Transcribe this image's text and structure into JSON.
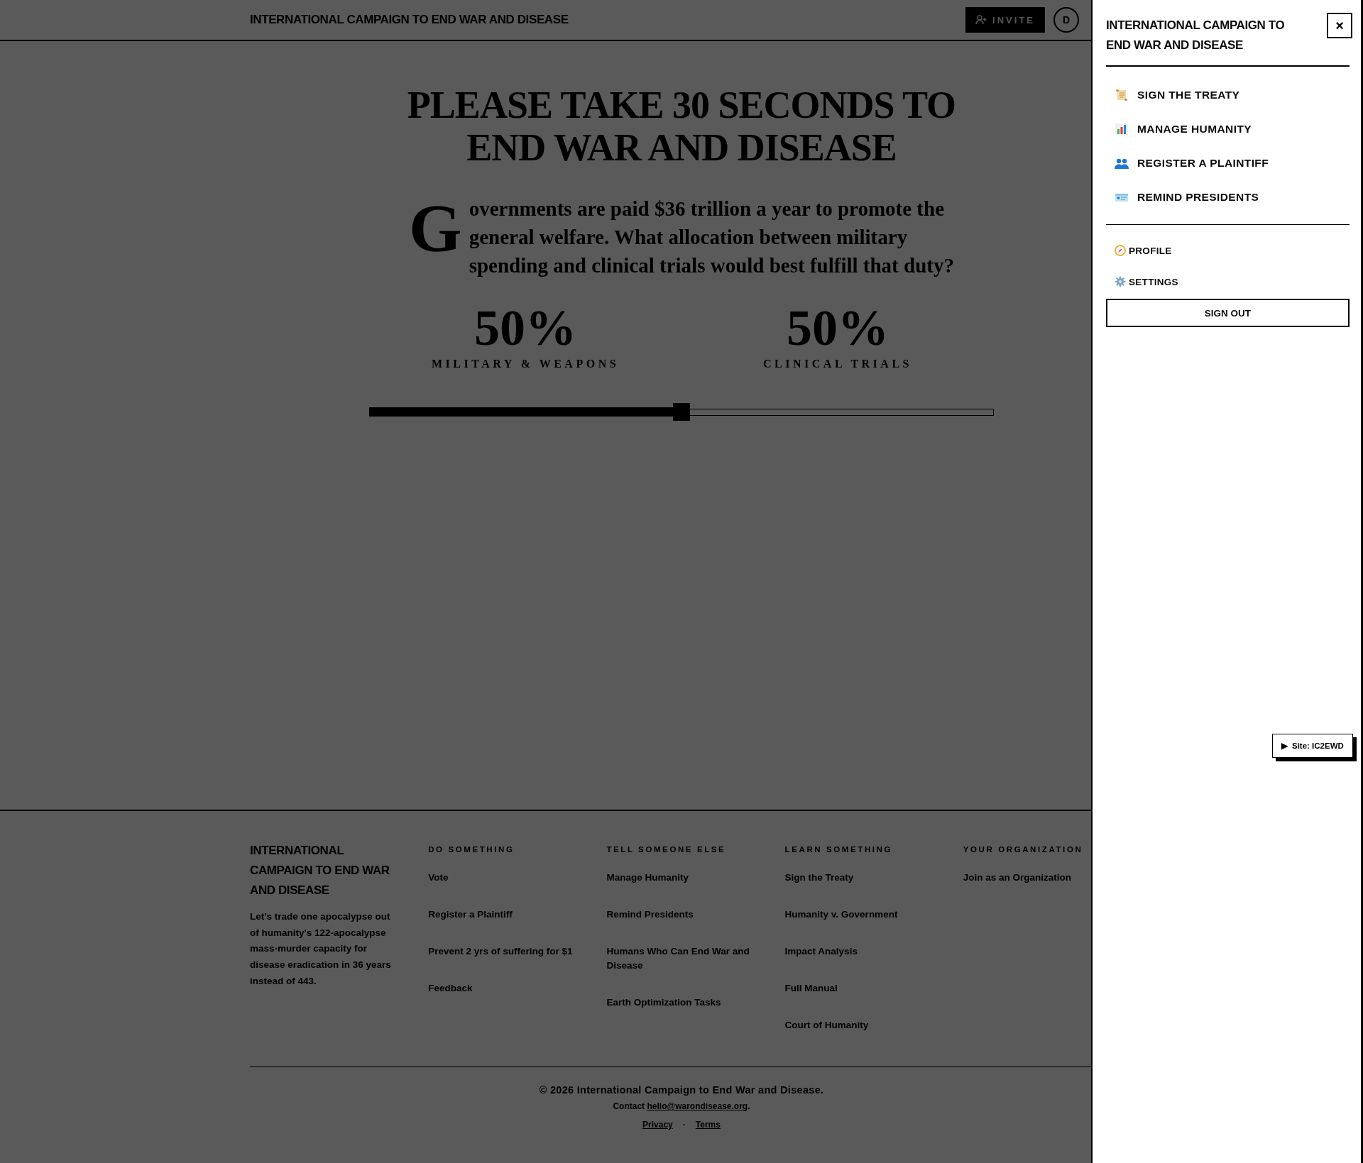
{
  "header": {
    "title": "INTERNATIONAL CAMPAIGN TO END WAR AND DISEASE",
    "invite_button": "INVITE",
    "avatar": "D"
  },
  "question": {
    "title": "PLEASE TAKE 30 SECONDS TO END WAR AND DISEASE",
    "drop_cap": "G",
    "text": "overnments are paid $36 trillion a year to promote the general welfare. What allocation between military spending and clinical trials would best fulfill that duty?"
  },
  "allocations": [
    {
      "value": "50%",
      "label": "MILITARY & WEAPONS"
    },
    {
      "value": "50%",
      "label": "CLINICAL TRIALS"
    }
  ],
  "slider": {
    "level": 0.5
  },
  "footer": {
    "brand": "INTERNATIONAL CAMPAIGN TO END WAR AND DISEASE",
    "tagline": "Let's trade one apocalypse out of humanity's **122**-apocalypse mass-murder capacity for disease eradication in **36** years instead of **443**.",
    "columns": [
      {
        "heading": "DO SOMETHING",
        "links": [
          "Vote",
          "Register a Plaintiff",
          "Prevent 2 yrs of suffering for $1",
          "Feedback"
        ]
      },
      {
        "heading": "TELL SOMEONE ELSE",
        "links": [
          "Manage Humanity",
          "Remind Presidents",
          "Humans Who Can End War and Disease",
          "Earth Optimization Tasks"
        ]
      },
      {
        "heading": "LEARN SOMETHING",
        "links": [
          "Sign the Treaty",
          "Humanity v. Government",
          "Impact Analysis",
          "Full Manual",
          "Court of Humanity"
        ]
      },
      {
        "heading": "YOUR ORGANIZATION",
        "links": [
          "Join as an Organization"
        ]
      }
    ],
    "copyright": "© 2026 International Campaign to End War and Disease.",
    "contact_prefix": "Contact",
    "contact_email": "hello@warondisease.org",
    "contact_suffix": ".",
    "legal_links": [
      "Privacy",
      "Terms"
    ],
    "separator": "·"
  },
  "drawer": {
    "title": "INTERNATIONAL CAMPAIGN TO END WAR AND DISEASE",
    "close": "×",
    "primary_items": [
      "SIGN THE TREATY",
      "MANAGE HUMANITY",
      "REGISTER A PLAINTIFF",
      "REMIND PRESIDENTS"
    ],
    "secondary_items": [
      "PROFILE",
      "SETTINGS"
    ],
    "sign_out": "SIGN OUT"
  },
  "site_badge": {
    "arrow": "▶",
    "label": "Site: IC2EWD"
  }
}
